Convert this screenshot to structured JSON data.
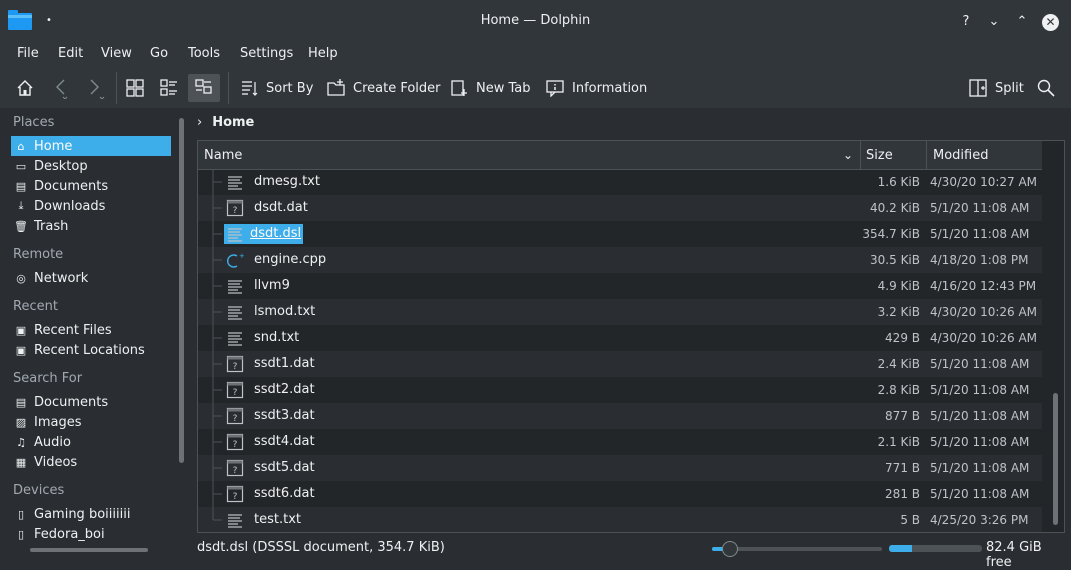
{
  "window": {
    "title": "Home — Dolphin",
    "pin_glyph": "•",
    "buttons": {
      "help": "?",
      "minimize": "⌄",
      "maximize": "⌃",
      "close": "✕"
    }
  },
  "menubar": [
    "File",
    "Edit",
    "View",
    "Go",
    "Tools",
    "Settings",
    "Help"
  ],
  "toolbar": {
    "sort_by": "Sort By",
    "create_folder": "Create Folder",
    "new_tab": "New Tab",
    "information": "Information",
    "split": "Split"
  },
  "sidebar": {
    "places_heading": "Places",
    "places": [
      {
        "label": "Home",
        "icon": "home-icon",
        "glyph": "⌂"
      },
      {
        "label": "Desktop",
        "icon": "desktop-icon",
        "glyph": "▭"
      },
      {
        "label": "Documents",
        "icon": "documents-icon",
        "glyph": "▤"
      },
      {
        "label": "Downloads",
        "icon": "downloads-icon",
        "glyph": "⤓"
      },
      {
        "label": "Trash",
        "icon": "trash-icon",
        "glyph": "🗑"
      }
    ],
    "remote_heading": "Remote",
    "remote": [
      {
        "label": "Network",
        "icon": "network-icon",
        "glyph": "◎"
      }
    ],
    "recent_heading": "Recent",
    "recent": [
      {
        "label": "Recent Files",
        "icon": "recent-files-icon",
        "glyph": "▣"
      },
      {
        "label": "Recent Locations",
        "icon": "recent-locations-icon",
        "glyph": "▣"
      }
    ],
    "search_heading": "Search For",
    "search": [
      {
        "label": "Documents",
        "icon": "search-documents-icon",
        "glyph": "▤"
      },
      {
        "label": "Images",
        "icon": "images-icon",
        "glyph": "▨"
      },
      {
        "label": "Audio",
        "icon": "audio-icon",
        "glyph": "♫"
      },
      {
        "label": "Videos",
        "icon": "videos-icon",
        "glyph": "▦"
      }
    ],
    "devices_heading": "Devices",
    "devices": [
      {
        "label": "Gaming boiiiiiii",
        "icon": "drive-icon",
        "glyph": "▯"
      },
      {
        "label": "Fedora_boi",
        "icon": "drive-icon",
        "glyph": "▯"
      }
    ]
  },
  "breadcrumb": {
    "current": "Home",
    "chevron": "›"
  },
  "columns": {
    "name": "Name",
    "size": "Size",
    "modified": "Modified",
    "sort_glyph": "⌄"
  },
  "files": [
    {
      "name": "dmesg.txt",
      "type": "text",
      "size": "1.6 KiB",
      "modified": "4/30/20 10:27 AM"
    },
    {
      "name": "dsdt.dat",
      "type": "unknown",
      "size": "40.2 KiB",
      "modified": "5/1/20 11:08 AM"
    },
    {
      "name": "dsdt.dsl",
      "type": "text",
      "size": "354.7 KiB",
      "modified": "5/1/20 11:08 AM",
      "selected": true
    },
    {
      "name": "engine.cpp",
      "type": "cpp",
      "size": "30.5 KiB",
      "modified": "4/18/20 1:08 PM"
    },
    {
      "name": "llvm9",
      "type": "text",
      "size": "4.9 KiB",
      "modified": "4/16/20 12:43 PM"
    },
    {
      "name": "lsmod.txt",
      "type": "text",
      "size": "3.2 KiB",
      "modified": "4/30/20 10:26 AM"
    },
    {
      "name": "snd.txt",
      "type": "text",
      "size": "429 B",
      "modified": "4/30/20 10:26 AM"
    },
    {
      "name": "ssdt1.dat",
      "type": "unknown",
      "size": "2.4 KiB",
      "modified": "5/1/20 11:08 AM"
    },
    {
      "name": "ssdt2.dat",
      "type": "unknown",
      "size": "2.8 KiB",
      "modified": "5/1/20 11:08 AM"
    },
    {
      "name": "ssdt3.dat",
      "type": "unknown",
      "size": "877 B",
      "modified": "5/1/20 11:08 AM"
    },
    {
      "name": "ssdt4.dat",
      "type": "unknown",
      "size": "2.1 KiB",
      "modified": "5/1/20 11:08 AM"
    },
    {
      "name": "ssdt5.dat",
      "type": "unknown",
      "size": "771 B",
      "modified": "5/1/20 11:08 AM"
    },
    {
      "name": "ssdt6.dat",
      "type": "unknown",
      "size": "281 B",
      "modified": "5/1/20 11:08 AM"
    },
    {
      "name": "test.txt",
      "type": "text",
      "size": "5 B",
      "modified": "4/25/20 3:26 PM"
    }
  ],
  "status": {
    "text": "dsdt.dsl (DSSSL document, 354.7 KiB)",
    "free_space": "82.4 GiB free",
    "zoom_fraction": 0.1,
    "used_space_fraction": 0.25
  },
  "colors": {
    "accent": "#3daee9",
    "window_bg": "#2a2e32",
    "chrome": "#31363b",
    "view_bg": "#232629"
  }
}
